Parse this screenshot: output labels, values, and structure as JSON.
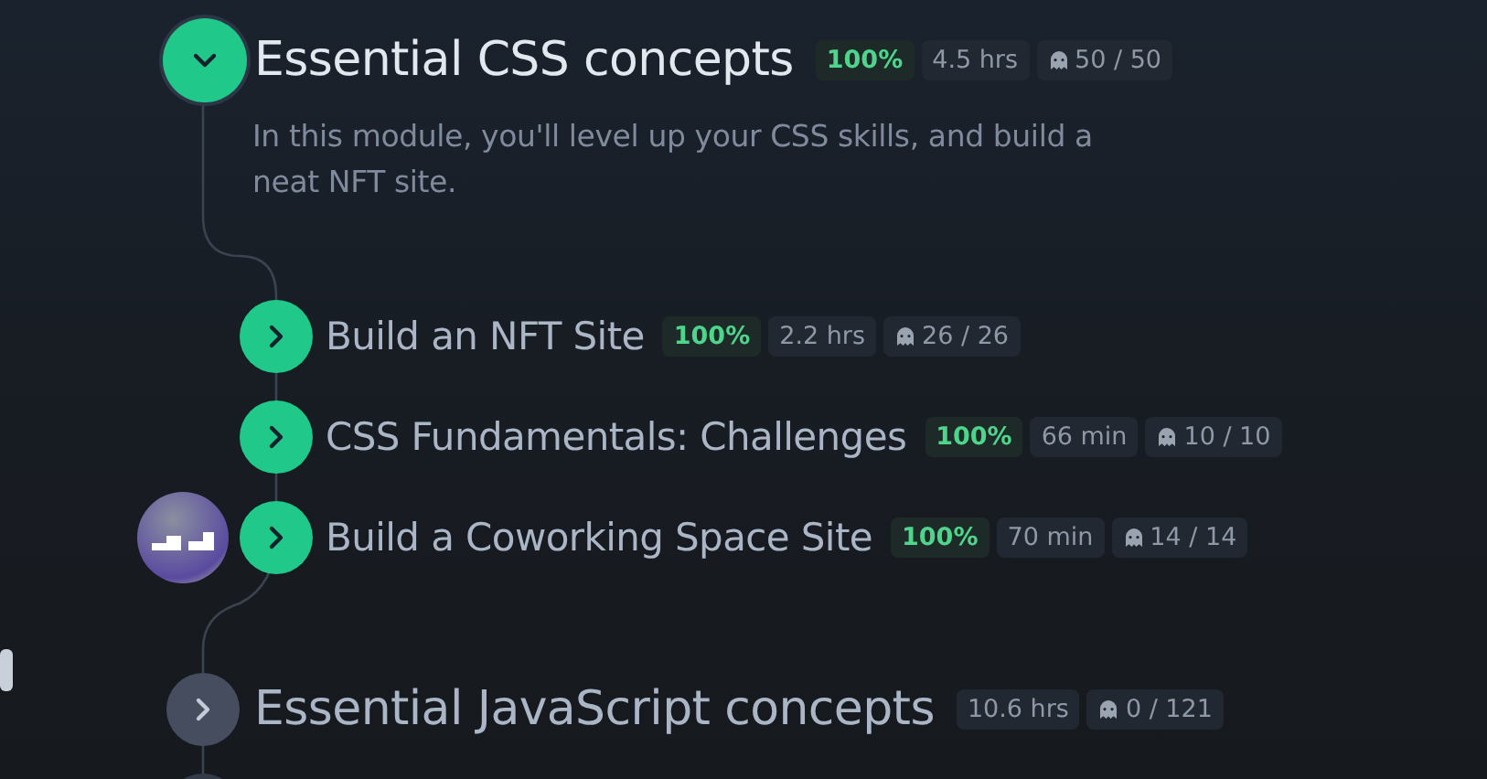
{
  "modules": [
    {
      "title": "Essential CSS concepts",
      "expanded": true,
      "completed": true,
      "progress": "100%",
      "duration": "4.5 hrs",
      "tasks": "50 / 50",
      "description": "In this module, you'll level up your CSS skills, and build a neat NFT site.",
      "lessons": [
        {
          "title": "Build an NFT Site",
          "completed": true,
          "avatar": false,
          "progress": "100%",
          "duration": "2.2 hrs",
          "tasks": "26 / 26"
        },
        {
          "title": "CSS Fundamentals: Challenges",
          "completed": true,
          "avatar": false,
          "progress": "100%",
          "duration": "66 min",
          "tasks": "10 / 10"
        },
        {
          "title": "Build a Coworking Space Site",
          "completed": true,
          "avatar": true,
          "progress": "100%",
          "duration": "70 min",
          "tasks": "14 / 14"
        }
      ]
    },
    {
      "title": "Essential JavaScript concepts",
      "expanded": false,
      "completed": false,
      "duration": "10.6 hrs",
      "tasks": "0 / 121"
    }
  ]
}
